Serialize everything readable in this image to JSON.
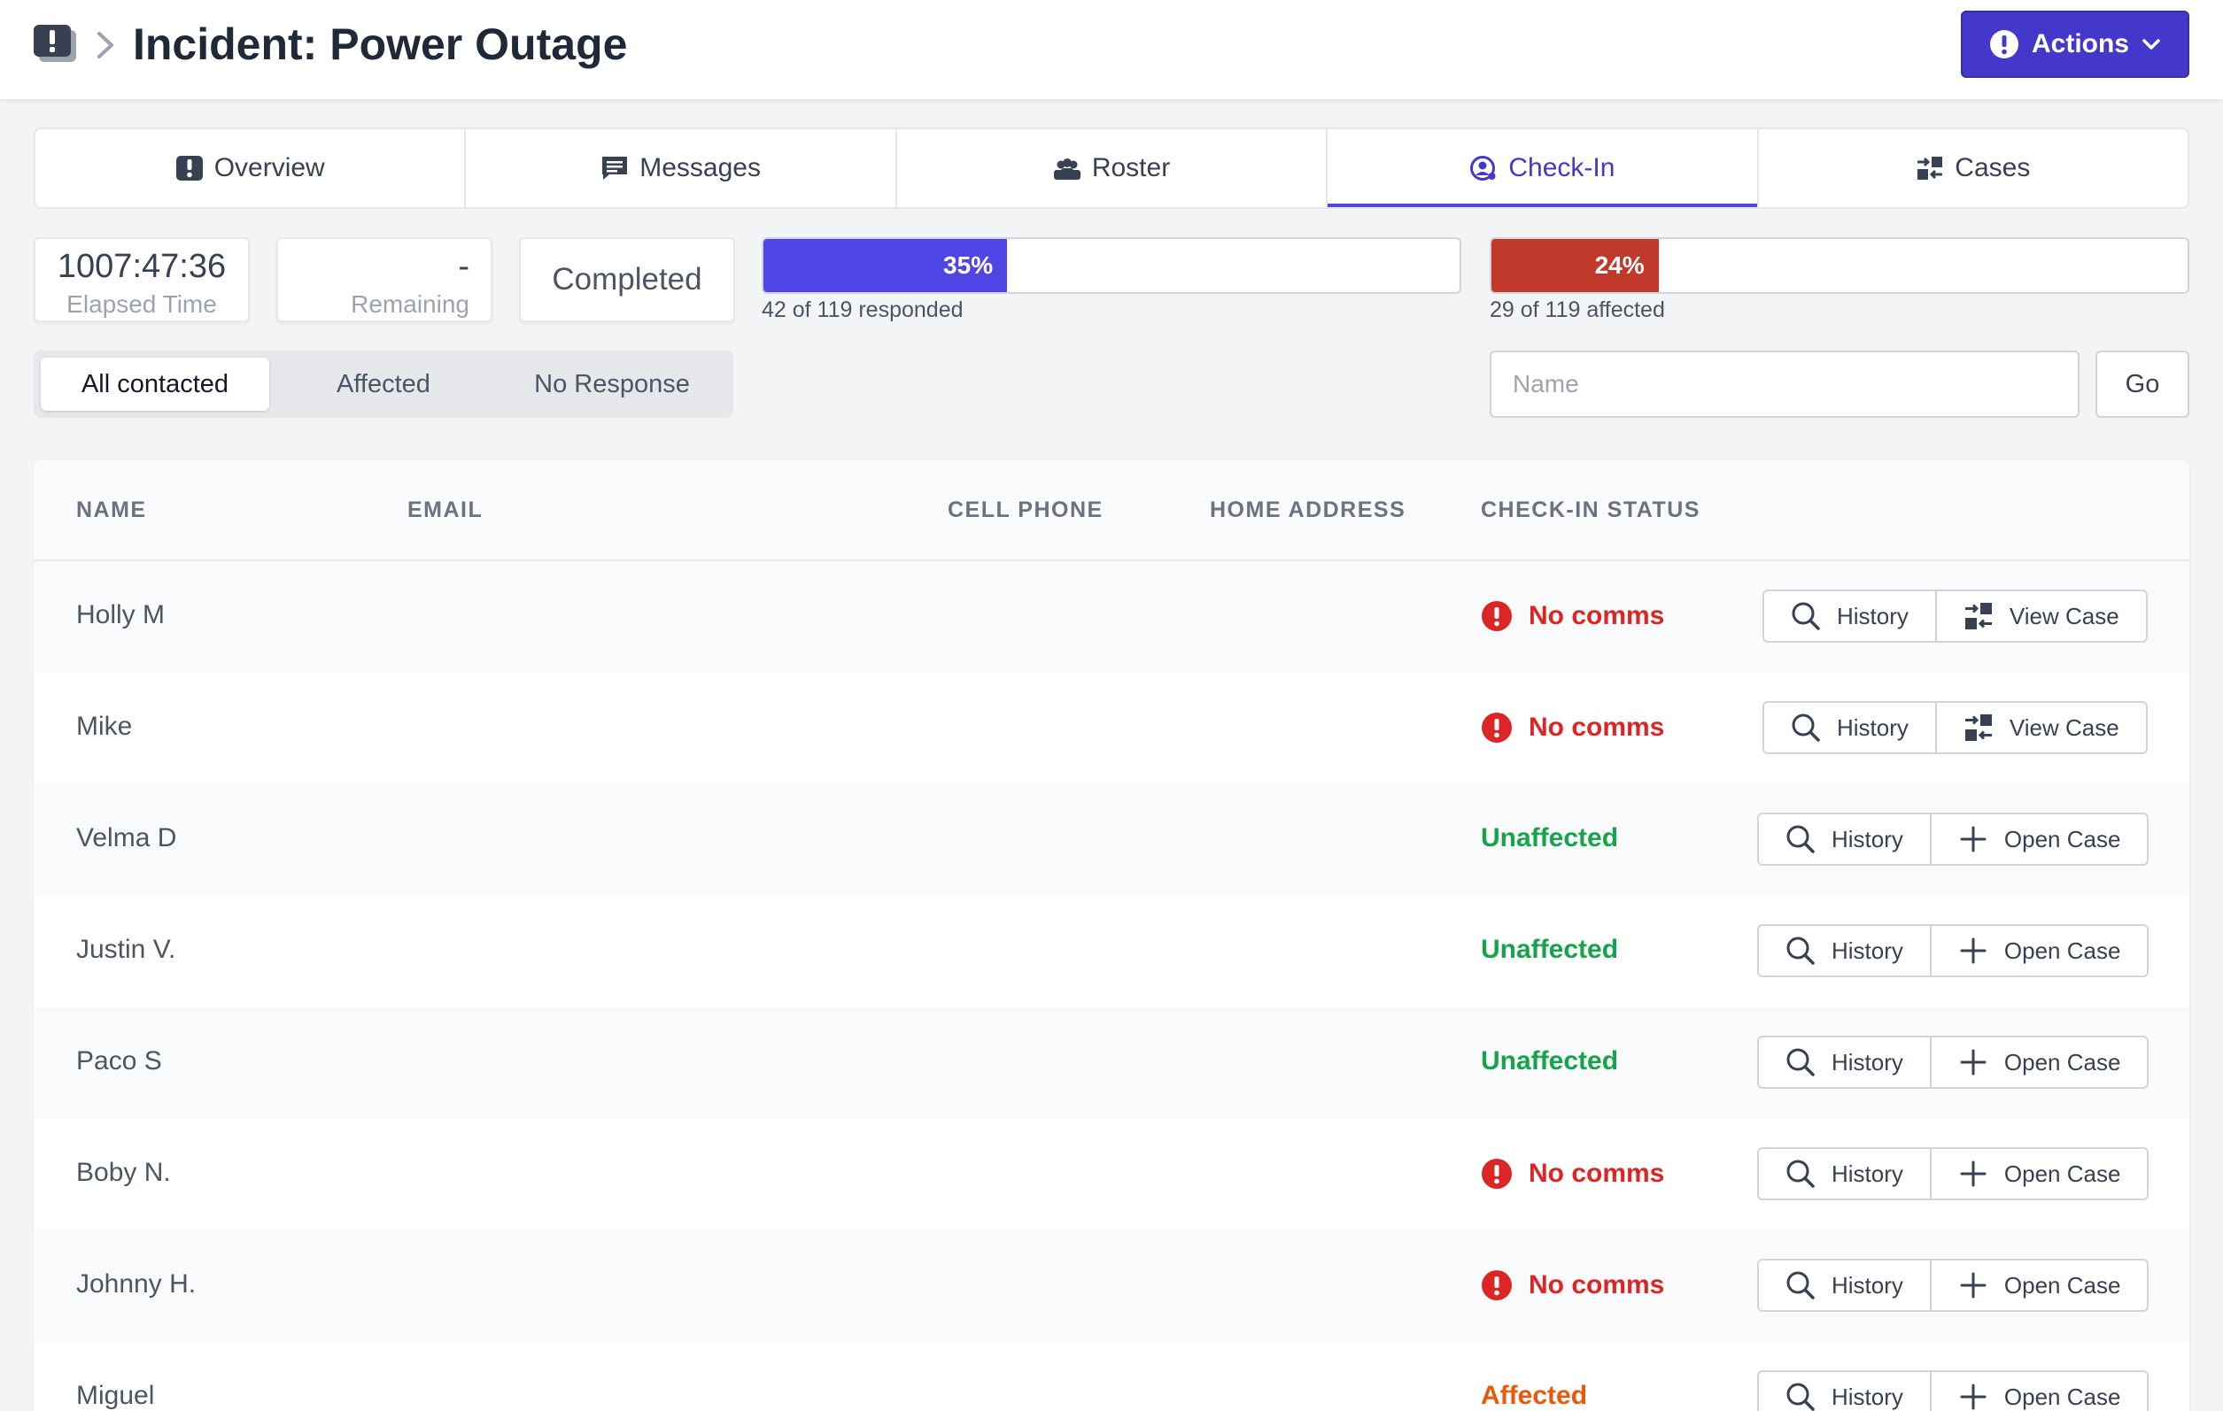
{
  "header": {
    "title": "Incident: Power Outage",
    "actions_label": "Actions"
  },
  "tabs": [
    {
      "label": "Overview",
      "icon": "exclamation-box-icon"
    },
    {
      "label": "Messages",
      "icon": "message-icon"
    },
    {
      "label": "Roster",
      "icon": "people-icon"
    },
    {
      "label": "Check-In",
      "icon": "user-circle-icon",
      "active": true
    },
    {
      "label": "Cases",
      "icon": "cases-icon"
    }
  ],
  "stats": {
    "elapsed": {
      "value": "1007:47:36",
      "label": "Elapsed Time"
    },
    "remaining": {
      "value": "-",
      "label": "Remaining"
    },
    "status": {
      "value": "Completed"
    }
  },
  "progress": {
    "responded": {
      "percent_label": "35%",
      "fraction": 0.35,
      "caption": "42 of 119 responded",
      "color": "#4f46e5"
    },
    "affected": {
      "percent_label": "24%",
      "fraction": 0.24,
      "caption": "29 of 119 affected",
      "color": "#c0392b"
    }
  },
  "filters": {
    "options": [
      "All contacted",
      "Affected",
      "No Response"
    ],
    "selected": "All contacted"
  },
  "search": {
    "placeholder": "Name",
    "value": "",
    "go_label": "Go"
  },
  "table": {
    "columns": [
      "NAME",
      "EMAIL",
      "CELL PHONE",
      "HOME ADDRESS",
      "CHECK-IN STATUS"
    ],
    "history_label": "History",
    "rows": [
      {
        "name": "Holly M",
        "status": "No comms",
        "case_action": "View Case"
      },
      {
        "name": "Mike",
        "status": "No comms",
        "case_action": "View Case"
      },
      {
        "name": "Velma D",
        "status": "Unaffected",
        "case_action": "Open Case"
      },
      {
        "name": "Justin V.",
        "status": "Unaffected",
        "case_action": "Open Case"
      },
      {
        "name": "Paco S",
        "status": "Unaffected",
        "case_action": "Open Case"
      },
      {
        "name": "Boby N.",
        "status": "No comms",
        "case_action": "Open Case"
      },
      {
        "name": "Johnny H.",
        "status": "No comms",
        "case_action": "Open Case"
      },
      {
        "name": "Miguel",
        "status": "Affected",
        "case_action": "Open Case"
      }
    ]
  },
  "colors": {
    "accent": "#4338ca",
    "no_comms": "#dc2626",
    "unaffected": "#16a34a",
    "affected": "#ea580c"
  }
}
